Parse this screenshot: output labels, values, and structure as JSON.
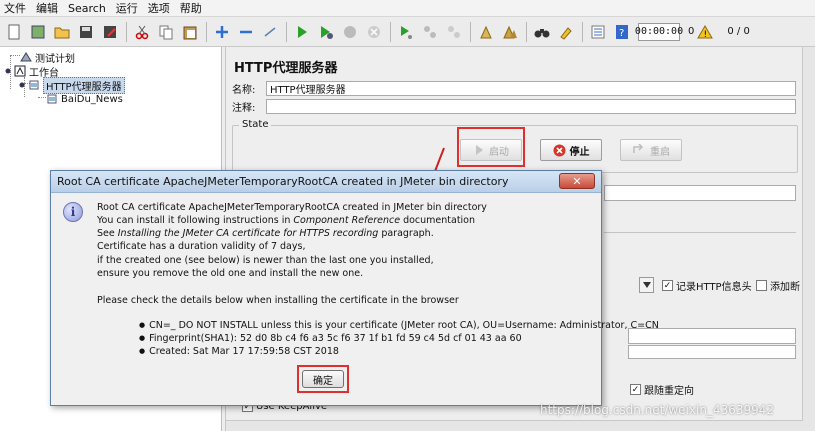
{
  "menu": [
    "文件",
    "编辑",
    "Search",
    "运行",
    "选项",
    "帮助"
  ],
  "toolbar": {
    "icons": [
      "new-icon",
      "templates-icon",
      "open-icon",
      "save-icon",
      "save-as-icon",
      "cut-icon",
      "copy-icon",
      "paste-icon",
      "expand-icon",
      "collapse-icon",
      "toggle-icon",
      "start-icon",
      "start-no-pause-icon",
      "stop-icon",
      "shutdown-icon",
      "remote-start-icon",
      "remote-stop-icon",
      "remote-shutdown-icon",
      "clear-icon",
      "clear-all-icon",
      "search-icon",
      "reset-search-icon",
      "function-helper-icon",
      "help-icon"
    ],
    "timer": "00:00:00",
    "warnings": "0",
    "threads": "0 / 0"
  },
  "tree": {
    "items": [
      {
        "label": "测试计划"
      },
      {
        "label": "工作台"
      },
      {
        "label": "HTTP代理服务器"
      },
      {
        "label": "BaiDu_News"
      }
    ]
  },
  "panel": {
    "title": "HTTP代理服务器",
    "name_label": "名称:",
    "name_value": "HTTP代理服务器",
    "comment_label": "注释:",
    "state_legend": "State",
    "start_label": "启动",
    "stop_label": "停止",
    "restart_label": "重启",
    "record_http_label": "记录HTTP信息头",
    "add_label": "添加断",
    "follow_redirect_label": "跟随重定向",
    "keepalive_label": "Use KeepAlive"
  },
  "dialog": {
    "title": "Root CA certificate ApacheJMeterTemporaryRootCA created in JMeter bin directory",
    "close_label": "✕",
    "lines": [
      "Root CA certificate ApacheJMeterTemporaryRootCA created in JMeter bin directory",
      "You can install it following instructions in ",
      "See ",
      "Certificate has a duration validity of 7 days,",
      "if the created one (see below) is newer than the last one you installed,",
      "ensure you remove the old one and install the new one.",
      "Please check the details below when installing the certificate in the browser"
    ],
    "italic_component": "Component Reference",
    "after_component": " documentation",
    "italic_installing": "Installing the JMeter CA certificate for HTTPS recording",
    "after_installing": " paragraph.",
    "bullets": [
      "CN=_ DO NOT INSTALL unless this is your certificate (JMeter root CA), OU=Username: Administrator, C=CN",
      "Fingerprint(SHA1): 52 d0 8b c4 f6 a3 5c f6 37 1f b1 fd 59 c4 5d cf 01 43 aa 60",
      "Created: Sat Mar 17 17:59:58 CST 2018"
    ],
    "ok_label": "确定"
  },
  "watermark": "https://blog.csdn.net/weixin_43639942",
  "colors": {
    "highlight_red": "#e0302e",
    "selection": "#c8d9ee",
    "dialog_border": "#5a7fa8"
  }
}
